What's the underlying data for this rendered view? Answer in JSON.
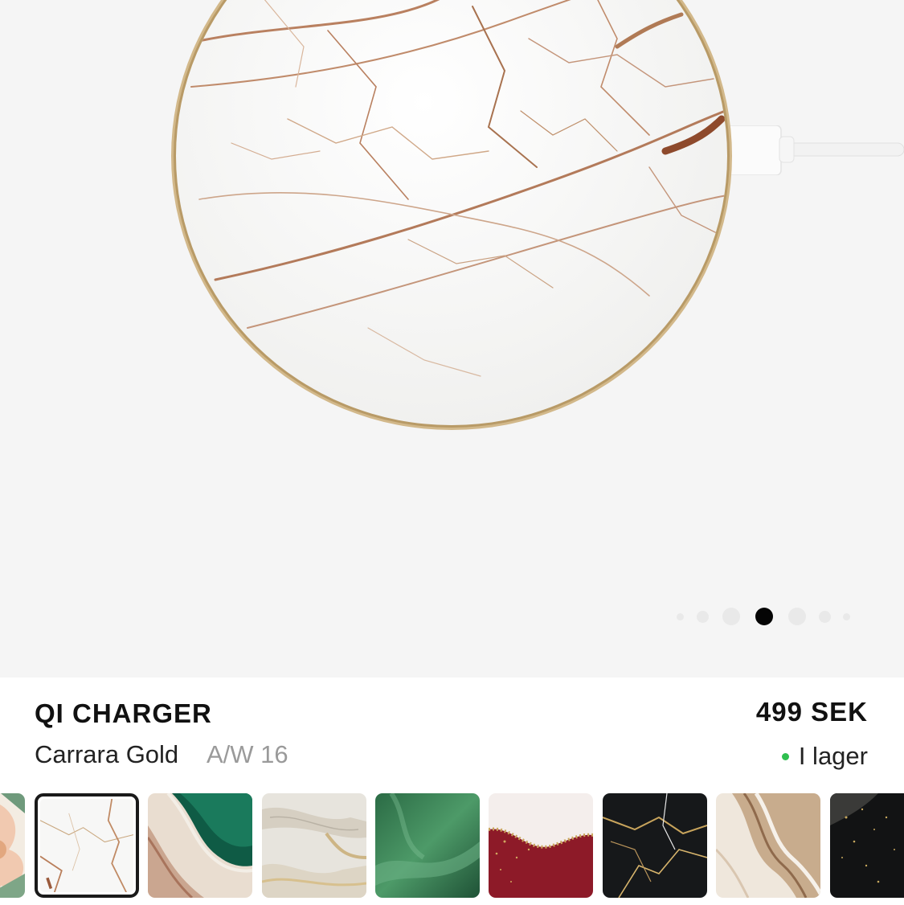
{
  "product": {
    "title": "QI CHARGER",
    "variant": "Carrara Gold",
    "collection": "A/W 16",
    "price": "499 SEK",
    "stock": "I lager"
  },
  "carousel": {
    "page_count": 7,
    "active_index": 3
  },
  "swatches": [
    {
      "name": "peach-floral",
      "selected": false
    },
    {
      "name": "carrara-gold",
      "selected": true
    },
    {
      "name": "emerald-agate",
      "selected": false
    },
    {
      "name": "champagne-marble",
      "selected": false
    },
    {
      "name": "green-satin",
      "selected": false
    },
    {
      "name": "red-gold-glitter",
      "selected": false
    },
    {
      "name": "black-gold-marble",
      "selected": false
    },
    {
      "name": "beige-agate",
      "selected": false
    },
    {
      "name": "black-gold-glitter",
      "selected": false
    }
  ],
  "colors": {
    "hero_background": "#f5f5f5",
    "rim_gold": "#c9ad7e",
    "in_stock": "#2fbf4f",
    "active_dot": "#050505"
  }
}
